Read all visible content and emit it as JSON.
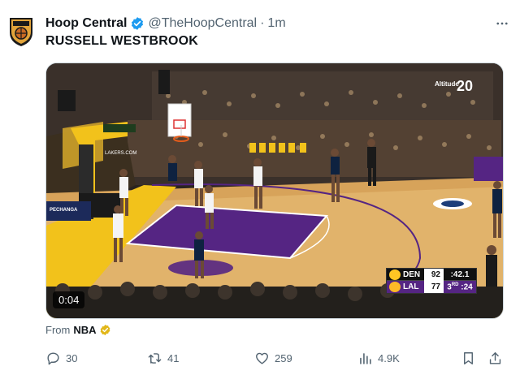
{
  "author": {
    "display_name": "Hoop Central",
    "handle": "@TheHoopCentral",
    "separator": "·",
    "timestamp": "1m",
    "verified_color": "#1d9bf0"
  },
  "tweet": {
    "text": "RUSSELL WESTBROOK"
  },
  "media": {
    "timer": "0:04",
    "scoreboard": {
      "home": {
        "team": "DEN",
        "score": "92",
        "extra": ":42.1"
      },
      "away": {
        "team": "LAL",
        "score": "77",
        "extra_quarter": "3",
        "extra_quarter_suffix": "RD",
        "extra_clock": ":24"
      }
    },
    "arena_logo": "20",
    "arena_logo_sub": "Altitude",
    "sponsor": "PECHANGA",
    "baseline_text": "LAKERS.COM"
  },
  "source": {
    "prefix": "From",
    "name": "NBA",
    "badge_color": "#e2b719"
  },
  "actions": {
    "replies": "30",
    "retweets": "41",
    "likes": "259",
    "views": "4.9K"
  },
  "colors": {
    "text_primary": "#0f1419",
    "text_secondary": "#536471",
    "lakers_purple": "#552583",
    "lakers_gold": "#fdb927",
    "nuggets_navy": "#0e2240"
  }
}
